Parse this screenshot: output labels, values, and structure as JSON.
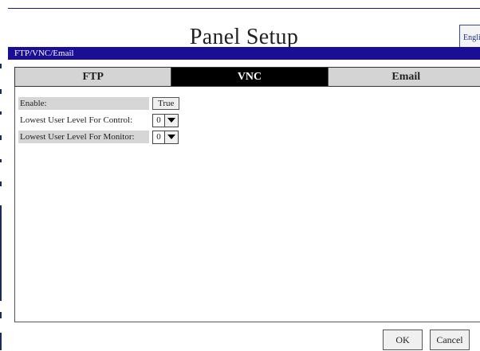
{
  "window": {
    "title": "Panel Setup",
    "language_button": "English"
  },
  "section": {
    "label": "FTP/VNC/Email"
  },
  "tabs": [
    {
      "label": "FTP",
      "active": false
    },
    {
      "label": "VNC",
      "active": true
    },
    {
      "label": "Email",
      "active": false
    }
  ],
  "vnc": {
    "enable_label": "Enable:",
    "enable_value": "True",
    "control_label": "Lowest User Level For Control:",
    "control_value": "0",
    "monitor_label": "Lowest User Level For Monitor:",
    "monitor_value": "0"
  },
  "footer": {
    "ok_label": "OK",
    "cancel_label": "Cancel"
  },
  "colors": {
    "section_bar": "#1a0d96",
    "tab_active_bg": "#000000",
    "tab_inactive_bg": "#d4d4d4"
  }
}
